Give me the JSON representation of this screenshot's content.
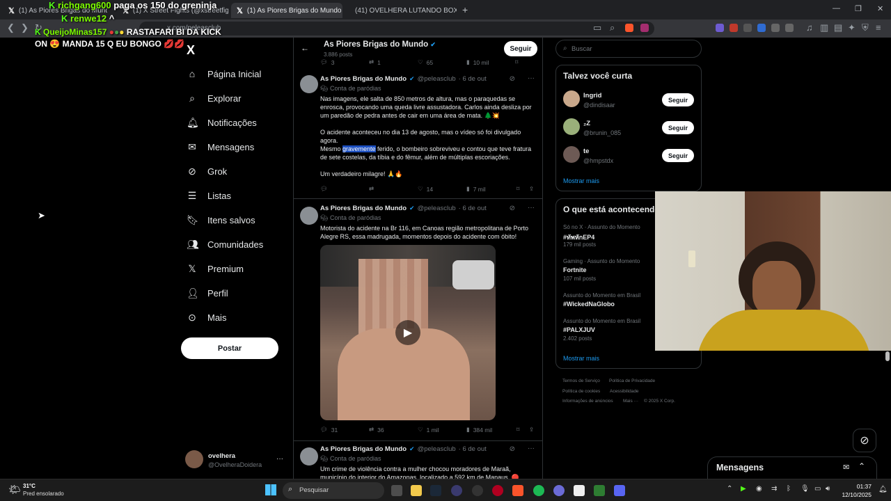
{
  "tabs": [
    {
      "label": "(1) As Piores Brigas do Mundo (@peleasclub) / X"
    },
    {
      "label": "(1) X Street Fights (@xstreetfights2"
    },
    {
      "label": "(1) As Piores Brigas do Mundo (@"
    },
    {
      "label": "(41) OVELHERA LUTANDO BOXE KKK"
    }
  ],
  "tab_new": "+",
  "url": "x.com/peleasclub",
  "chat": {
    "line1_nick": "richgang600",
    "line1_msg": "paga os 150 do greninja",
    "line2_nick": "renwe12",
    "line2_msg": "^",
    "line3_nick": "QueijoMinas157",
    "line3_msg": "RASTAFARI BI DA KICK ON",
    "line3_msg2": "MANDA 15 Q EU BONGO"
  },
  "sidebar": {
    "logo": "X",
    "items": [
      {
        "label": "Página Inicial"
      },
      {
        "label": "Explorar"
      },
      {
        "label": "Notificações"
      },
      {
        "label": "Mensagens"
      },
      {
        "label": "Grok"
      },
      {
        "label": "Listas"
      },
      {
        "label": "Itens salvos"
      },
      {
        "label": "Comunidades"
      },
      {
        "label": "Premium"
      },
      {
        "label": "Perfil"
      },
      {
        "label": "Mais"
      }
    ],
    "post_label": "Postar",
    "account_name": "ovelhera",
    "account_handle": "@OvelheraDoidera",
    "account_more": "···"
  },
  "header": {
    "title": "As Piores Brigas do Mundo",
    "posts": "3.886 posts",
    "follow": "Seguir",
    "back": "←"
  },
  "tweets": [
    {
      "top_actions": {
        "replies": "3",
        "retweets": "1",
        "likes": "65",
        "views": "10 mil"
      },
      "name": "As Piores Brigas do Mundo",
      "handle": "@peleasclub",
      "date": "· 6 de out",
      "parody": "Conta de paródias",
      "p1": "Nas imagens, ele salta de 850 metros de altura, mas o paraquedas se enrosca, provocando uma queda livre assustadora. Carlos ainda desliza por um paredão de pedra antes de cair em uma área de mata. 🌲💥",
      "p2": "O acidente aconteceu no dia 13 de agosto, mas o vídeo só foi divulgado agora.",
      "p3a": "Mesmo ",
      "p3hl": "gravemente",
      "p3b": " ferido, o bombeiro sobreviveu e contou que teve fratura de sete costelas, da tíbia e do fêmur, além de múltiplas escoriações.",
      "p4": "Um verdadeiro milagre! 🙏🔥",
      "replies": "",
      "retweets": "",
      "likes": "14",
      "views": "7 mil"
    },
    {
      "name": "As Piores Brigas do Mundo",
      "handle": "@peleasclub",
      "date": "· 6 de out",
      "parody": "Conta de paródias",
      "text": "Motorista do acidente na Br 116, em Canoas região metropolitana de Porto Alegre RS, essa madrugada, momentos depois do acidente com óbito!",
      "replies": "31",
      "retweets": "36",
      "likes": "1 mil",
      "views": "384 mil"
    },
    {
      "name": "As Piores Brigas do Mundo",
      "handle": "@peleasclub",
      "date": "· 6 de out",
      "parody": "Conta de paródias",
      "text": "Um crime de violência contra a mulher chocou moradores de Maraã, município do interior do Amazonas, localizado a 592 km de Manaus. 🔴"
    }
  ],
  "search": {
    "placeholder": "Buscar"
  },
  "who_to_follow": {
    "title": "Talvez você curta",
    "users": [
      {
        "name": "Ingrid",
        "handle": "@dindisaar",
        "btn": "Seguir"
      },
      {
        "name": "₂Z",
        "handle": "@brunin_085",
        "btn": "Seguir"
      },
      {
        "name": "te",
        "handle": "@hmpstdx",
        "btn": "Seguir"
      }
    ],
    "more": "Mostrar mais"
  },
  "trends": {
    "title": "O que está acontecendo",
    "items": [
      {
        "ctx": "Só no X · Assunto do Momento",
        "name": "#ทัพหักEP4",
        "count": "179 mil posts"
      },
      {
        "ctx": "Gaming · Assunto do Momento",
        "name": "Fortnite",
        "count": "107 mil posts"
      },
      {
        "ctx": "Assunto do Momento em Brasil",
        "name": "#WickedNaGlobo",
        "count": ""
      },
      {
        "ctx": "Assunto do Momento em Brasil",
        "name": "#PALXJUV",
        "count": "2.402 posts"
      }
    ],
    "more": "Mostrar mais"
  },
  "footer": {
    "l1": "Termos de Serviço",
    "l2": "Política de Privacidade",
    "l3": "Política de cookies",
    "l4": "Acessibilidade",
    "l5": "Informações de anúncios",
    "l6": "Mais ···",
    "l7": "© 2025 X Corp."
  },
  "messages_drawer": {
    "title": "Mensagens"
  },
  "taskbar": {
    "weather_temp": "31°C",
    "weather_desc": "Pred ensolarado",
    "search": "Pesquisar",
    "time": "01:37",
    "date": "12/10/2025"
  },
  "colors": {
    "accent": "#1d9bf0",
    "kick": "#53fc18",
    "bg": "#000000"
  }
}
